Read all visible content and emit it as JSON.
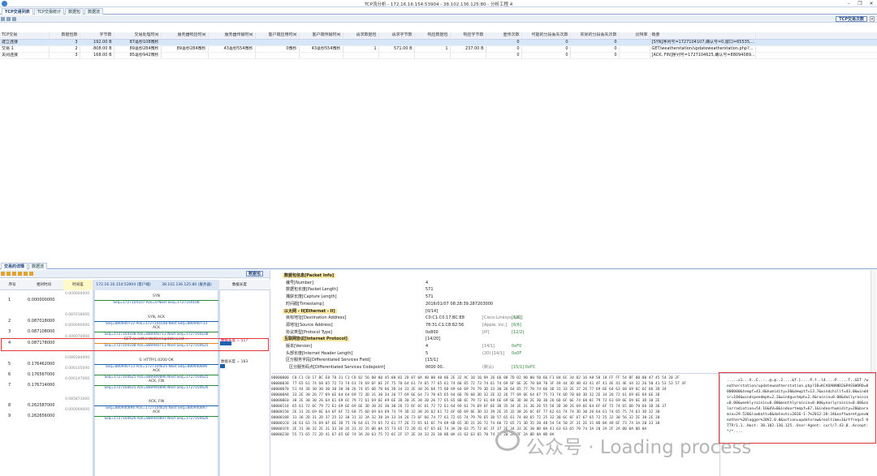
{
  "window": {
    "title": "TCP流分析 - 172.16.16.154:53904 - 38.102.136.125:80 - 分析工程 4",
    "controls": [
      "–",
      "❐",
      "✕"
    ]
  },
  "top_tabs": [
    "TCP交易列表",
    "TCP交易统计",
    "数据包",
    "数据流"
  ],
  "right_panel_button": "TCP交易次数",
  "right_panel_close": "×",
  "columns": [
    "TCP交易",
    "数据包数",
    "字节数",
    "交易处理时间",
    "服务器响应时间",
    "服务器传输时间",
    "客户端应用时间",
    "客户端传输时间",
    "请求数据包",
    "请求字节数",
    "响应数据包",
    "响应字节数",
    "重传次数",
    "可能的分段丢失次数",
    "实际的分段丢失次数",
    "比特率",
    "概要"
  ],
  "rows": [
    [
      "建立连接",
      "3",
      "192.00 B",
      "87毫秒108微秒",
      "",
      "",
      "",
      "",
      "",
      "",
      "",
      "",
      "0",
      "0",
      "0",
      "",
      "[SYN]序列号=1727104107,确认号=0,窗口=65535,..."
    ],
    [
      "交易 1",
      "2",
      "808.00 B",
      "89毫秒284微秒",
      "89毫秒284微秒",
      "43毫秒554微秒",
      "0微秒",
      "43毫秒554微秒",
      "1",
      "571.00 B",
      "1",
      "237.00 B",
      "0",
      "0",
      "0",
      "",
      "GET/weatherstation/updateweatherstation.php?..."
    ],
    [
      "关闭连接",
      "3",
      "168.00 B",
      "85毫秒942微秒",
      "",
      "",
      "",
      "",
      "",
      "",
      "",
      "",
      "0",
      "0",
      "0",
      "",
      "[ACK, FIN]序列号=1727104625,确认号=88094089..."
    ]
  ],
  "mid_tabs": [
    "交易的详情",
    "数据流"
  ],
  "left_button": "数据包",
  "flow_headers": {
    "seq": "序号",
    "rel": "相对时间",
    "delta": "时间差",
    "client": "172.16.16.154:53904 (客户端)",
    "server": "38.102.136.125:80 (服务器)",
    "len": "数据长度"
  },
  "frames": [
    {
      "n": "1",
      "t": "0.000000000",
      "d": "0.000000000",
      "label": "SYN",
      "seq": "Seq=1727104107  Ack=0  Next Seq=1727104108"
    },
    {
      "n": "2",
      "t": "0.087018000",
      "d": "0.087018000",
      "label": "SYN, ACK",
      "seq": "Seq=880940712  Ack=1727104108  Next Seq=880940713"
    },
    {
      "n": "3",
      "t": "0.087108000",
      "d": "0.000090000",
      "label": "ACK",
      "seq": "Seq=1727104108  Ack=880940713  Next Seq=1727104108"
    },
    {
      "n": "4",
      "t": "0.087178000",
      "d": "0.000070000",
      "label": "GET /weatherstation/updateweat ...",
      "seq": "Seq=1727104108  Ack=880940713  Next Seq=1727104625",
      "len": "数据长度 = 517"
    },
    {
      "n": "5",
      "t": "0.176462000",
      "d": "0.089284000",
      "label": "S: HTTP/1.0200 OK",
      "seq": "Seq=880940713  Ack=1727104625  Next Seq=880940896",
      "len": "数据长度 = 183"
    },
    {
      "n": "6",
      "t": "0.176567000",
      "d": "0.000105000",
      "label": "ACK",
      "seq": "Seq=1727104625  Ack=880940896  Next Seq=1727104625"
    },
    {
      "n": "7",
      "t": "0.176714000",
      "d": "0.000147000",
      "label": "ACK, FIN",
      "seq": "Seq=1727104625  Ack=880940896  Next Seq=1727104626"
    },
    {
      "n": "8",
      "t": "0.262587000",
      "d": "0.085873000",
      "label": "ACK, FIN",
      "seq": "Seq=880940896  Ack=1727104626  Next Seq=880940897"
    },
    {
      "n": "9",
      "t": "0.262656000",
      "d": "0.000069000",
      "label": "ACK",
      "seq": "Seq=1727104626  Ack=880940897  Next Seq=1727104626"
    }
  ],
  "tree": [
    {
      "t": "数据包信息[Packet Info]",
      "v": "",
      "cls": "sec"
    },
    {
      "t": "编号[Number]",
      "v": "4"
    },
    {
      "t": "数据包长度[Packet Length]",
      "v": "571"
    },
    {
      "t": "捕获长度[Capture Length]",
      "v": "571"
    },
    {
      "t": "时间戳[Timestamp]",
      "v": "2016/01/07 08:28:39.287203000"
    },
    {
      "t": "以太网 - II[Ethernet - II]",
      "v": "[0/14]",
      "cls": "sec2"
    },
    {
      "t": "目标地址[Destination Address]",
      "v": "C0:C1:C0:17:BC:E8",
      "v2": "[Cisco-Linksys, LLC]",
      "v3": "[0/6]"
    },
    {
      "t": "源地址[Source Address]",
      "v": "78:31:C1:C8:82:56",
      "v2": "[Apple, Inc.]",
      "v3": "[6/6]"
    },
    {
      "t": "协议类型[Protocol Type]",
      "v": "0x800",
      "v2": "[IP]",
      "v3": "[12/2]"
    },
    {
      "t": "互联网协议[Internet Protocol]",
      "v": "[14/20]",
      "cls": "sec"
    },
    {
      "t": "版本[Version]",
      "v": "4",
      "v2": "[14/1]",
      "v3": "0xF0"
    },
    {
      "t": "头部长度[Internet Header Length]",
      "v": "5",
      "v2": "(20) [14/1]",
      "v3": "0x0F"
    },
    {
      "t": "区分服务字段[Differentiated Services Field]",
      "v": "[15/1]"
    },
    {
      "t": "区分服务码点[Differentiated Services Codepoint]",
      "v": "0000 00..",
      "v2": "(默认)",
      "v3": "[15/1] 0xFC"
    }
  ],
  "hex": [
    [
      "00000000",
      "C0 C1 C0 17 BC E8 78 31 C1 C8 82 56 08 00 45 00 02 2D 07 0A 40 00 40 06 2E 32 AC 10 10 9A 26 66 88 7D D2 90 00 50 66 F1 04 6C 34 82 16 A8 50 18 FF FF 54 BF 00 00 47 45 54 20 2F"
    ],
    [
      "00000038",
      "77 65 61 74 68 65 72 73 74 61 74 69 6F 6E 2F 75 70 64 61 74 65 77 65 61 74 68 65 72 73 74 61 74 69 6F 6E 2E 70 68 70 3F 49 44 3D 4B 43 41 4F 41 4E 41 4E 44 32 26 50 41 53 53 57 4F"
    ],
    [
      "00000070",
      "51 44 3D 30 30 30 30 30 30 26 74 65 6D 70 66 3D 34 33 2E 30 26 68 75 6D 69 64 69 74 79 3D 33 30 26 64 65 77 70 74 66 3D 31 33 2E 37 26 77 69 6E 64 63 68 69 6C 6C 66 3D 34"
    ],
    [
      "000000A8",
      "33 2E 30 26 77 69 6E 64 64 69 72 3D 31 30 34 26 77 69 6E 64 73 70 65 65 64 6D 70 68 3D 32 2E 32 26 77 69 6E 64 67 75 73 74 6D 70 68 3D 32 2E 34 26 72 61 69 6E 69 6E 3D"
    ],
    [
      "000000E0",
      "30 2E 30 30 26 64 61 69 6C 79 72 61 69 6E 69 6E 3D 30 2E 30 30 26 77 65 65 6B 6C 79 72 61 69 6E 69 6E 3D 30 2E 30 30 26 6D 6F 6E 74 68 6C 79 72 61 69 6E 69 6E 3D 30 2E"
    ],
    [
      "00000118",
      "65 61 72 6C 79 72 61 69 6E 69 6E 3D 30 2E 30 30 26 73 6F 6C 61 72 72 61 64 69 61 74 69 6F 6E 3D 35 34 2E 31 36 26 55 56 3D 30 26 69 6E 64 6F 6F 72 74 65 6D 70 66 3D 36 37"
    ],
    [
      "00000150",
      "2E 31 26 69 6E 64 6F 6F 72 68 75 6D 69 64 69 74 79 3D 32 38 26 62 61 72 6F 6D 69 6E 3D 32 39 2E 35 32 38 26 6C 6F 77 62 61 74 74 3D 30 26 64 61 74 65 75 74 63 3D 32 30"
    ],
    [
      "00000188",
      "31 36 2D 31 2D 37 25 32 30 31 32 3A 32 38 3A 33 34 26 73 6F 66 74 77 61 72 65 74 79 70 65 3D 57 65 61 74 68 65 72 25 32 30 6C 6F 67 67 65 72 25 32 30 56 32 2E 30 2E 30"
    ],
    [
      "000001C0",
      "26 61 63 74 69 6F 6E 3D 75 70 64 61 74 65 72 61 77 26 72 65 61 6C 74 69 6D 65 3D 31 26 72 74 66 72 65 71 3D 35 20 48 54 54 50 2F 31 2E 31 0D 0A 48 6F 73 74 3A 20 33 38"
    ],
    [
      "000001F8",
      "2E 31 30 32 2E 31 33 36 2E 31 32 35 0D 0A 55 73 65 72 2D 41 67 65 6E 74 3A 20 63 75 72 6C 2F 37 2E 34 33 2E 30 0D 0A 41 63 63 65 70 74 3A 20 2A 2F 2A 0D 0A 0D 0A"
    ],
    [
      "00000230",
      "55 73 65 72 2D 41 67 65 6E 74 3A 20 63 75 72 6C 2F 37 2E 34 33 2E 30 0D 0A 41 63 63 65 70 74 3A 20 2A 2F 2A 0D 0A 0D 0A"
    ]
  ],
  "ascii": ".....x1...V..E..-..@.@..2....&f.}....P.f..l4....P.....T..GET /weatherstation/updateweatherstation.php?ID=KCAOANAND2&PASSWORD=0000000&tempf=43.0&humidity=30&dewptf=13.7&windchillf=43.0&winddir=104&windspeedmph=2.2&windgustmph=2.4&rainin=0.00&dailyrainin=0.00&weeklyrainin=0.00&monthlyrainin=0.00&yearlyrainin=0.00&solarradiation=54.16&UV=0&indoortempf=67.1&indoorhumidity=28&baromin=29.528&lowbatt=0&dateutc=2016-1-7%2012:28:34&softwaretype=Weather%20logger%20V2.0.0&action=updateraw&realtime=1&rtfreq=5 HTTP/1.1..Host: 38.102.136.125..User-Agent: curl/7.43.0..Accept: */*....",
  "watermark": "公众号 · Loading process"
}
